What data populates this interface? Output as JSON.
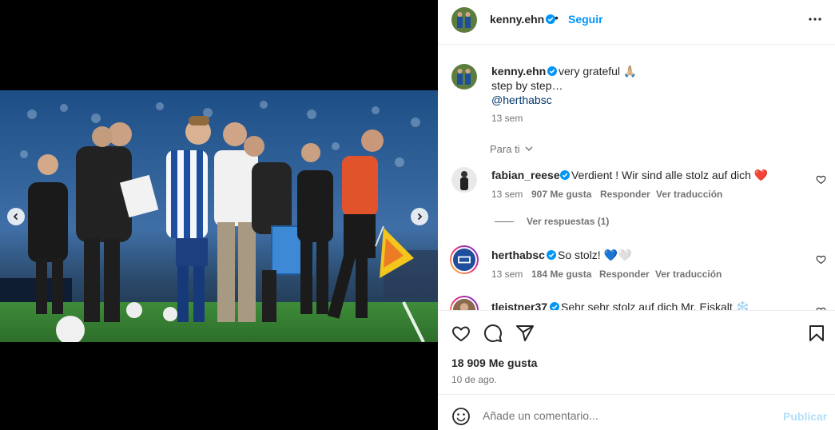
{
  "post": {
    "author": "kenny.ehn",
    "follow_label": "Seguir",
    "separator": "•",
    "more_icon": "more-horizontal-icon"
  },
  "caption": {
    "username": "kenny.ehn",
    "text": "very grateful 🙏🏼",
    "line2": "step by step…",
    "mention": "@herthabsc",
    "time": "13 sem"
  },
  "filter": {
    "label": "Para ti"
  },
  "comments": [
    {
      "username": "fabian_reese",
      "text": "Verdient ! Wir sind alle stolz auf dich ❤️",
      "time": "13 sem",
      "likes": "907 Me gusta",
      "reply": "Responder",
      "translate": "Ver traducción",
      "view_replies": "Ver respuestas (1)"
    },
    {
      "username": "herthabsc",
      "text": "So stolz! 💙🤍",
      "time": "13 sem",
      "likes": "184 Me gusta",
      "reply": "Responder",
      "translate": "Ver traducción"
    },
    {
      "username": "tleistner37",
      "text": "Sehr sehr stolz auf dich Mr. Eiskalt ❄️"
    }
  ],
  "stats": {
    "likes": "18 909 Me gusta",
    "date": "10 de ago."
  },
  "composer": {
    "placeholder": "Añade un comentario...",
    "publish_label": "Publicar"
  },
  "colors": {
    "accent": "#0095f6",
    "verified": "#0095f6",
    "muted": "#737373",
    "publish_disabled": "#b2dffc"
  }
}
